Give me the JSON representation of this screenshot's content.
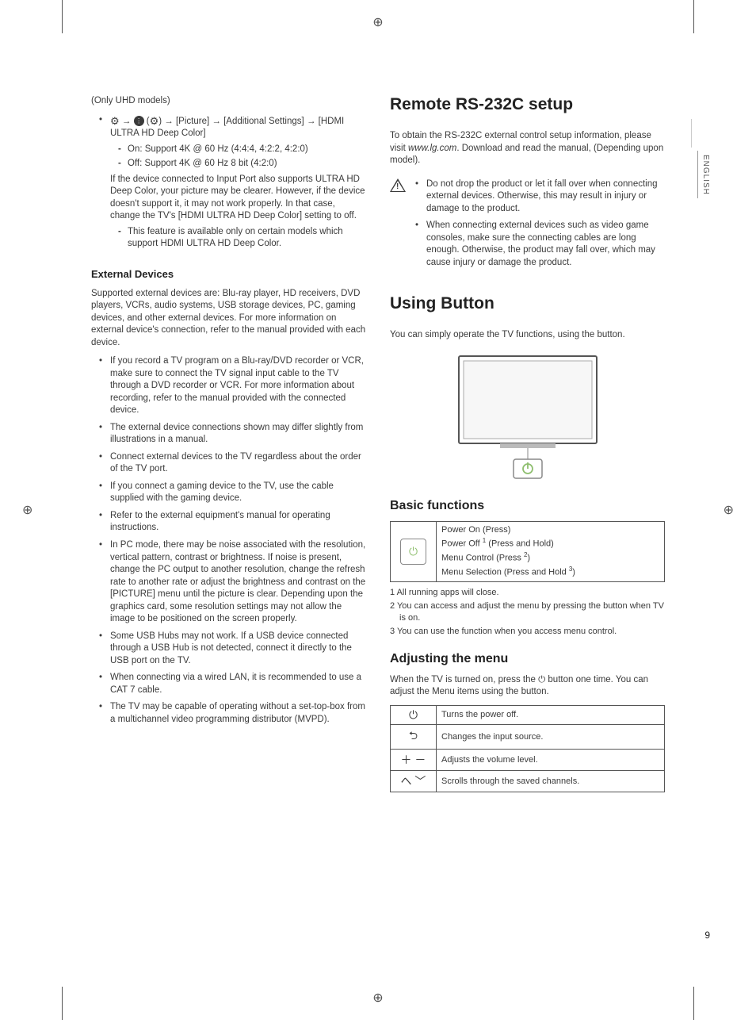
{
  "sidebar": {
    "language": "ENGLISH"
  },
  "page_number": "9",
  "left": {
    "uhd_note": "(Only UHD models)",
    "menu_path": {
      "arrow": "→",
      "picture": "[Picture]",
      "additional": "[Additional Settings]",
      "hdmi": "[HDMI ULTRA HD Deep Color]"
    },
    "uhd_options": {
      "on": "On: Support 4K @ 60 Hz (4:4:4, 4:2:2, 4:2:0)",
      "off": "Off: Support 4K @ 60 Hz 8 bit (4:2:0)"
    },
    "uhd_desc": "If the device connected to Input Port also supports ULTRA HD Deep Color, your picture may be clearer. However, if the device doesn't support it, it may not work properly. In that case, change the TV's [HDMI ULTRA HD Deep Color] setting to off.",
    "uhd_feature_note": "This feature is available only on certain models which support HDMI ULTRA HD Deep Color.",
    "ext_heading": "External Devices",
    "ext_intro": "Supported external devices are: Blu-ray player, HD receivers, DVD players, VCRs, audio systems, USB storage devices, PC, gaming devices, and other external devices. For more information on external device's connection, refer to the manual provided with each device.",
    "ext_bullets": [
      "If you record a TV program on a Blu-ray/DVD recorder or VCR, make sure to connect the TV signal input cable to the TV through a DVD recorder or VCR. For more information about recording, refer to the manual provided with the connected device.",
      "The external device connections shown may differ slightly from illustrations in a manual.",
      "Connect external devices to the TV regardless about the order of the TV port.",
      "If you connect a gaming device to the TV, use the cable supplied with the gaming device.",
      "Refer to the external equipment's manual for operating instructions.",
      "In PC mode, there may be noise associated with the resolution, vertical pattern, contrast or brightness. If noise is present, change the PC output to another resolution, change the refresh rate to another rate or adjust the brightness and contrast on the [PICTURE] menu until the picture is clear. Depending upon the graphics card, some resolution settings may not allow the image to be positioned on the screen properly.",
      "Some USB Hubs may not work. If a USB device connected through a USB Hub is not detected, connect it directly to the USB port on the TV.",
      "When connecting via a wired LAN, it is recommended to use a CAT 7 cable.",
      "The TV may be capable of operating without a set-top-box from a multichannel video programming distributor (MVPD)."
    ]
  },
  "right": {
    "rs232c_title": "Remote RS-232C setup",
    "rs232c_intro_a": "To obtain the RS-232C external control setup information, please visit ",
    "rs232c_url": "www.lg.com",
    "rs232c_intro_b": ". Download and read the manual, (Depending upon model).",
    "warnings": [
      "Do not drop the product or let it fall over when connecting external devices. Otherwise, this may result in injury or damage to the product.",
      "When connecting external devices such as video game consoles, make sure the connecting cables are long enough. Otherwise, the product may fall over, which may cause injury or damage the product."
    ],
    "using_button_title": "Using Button",
    "using_button_intro": "You can simply operate the TV functions, using the button.",
    "basic_functions_title": "Basic functions",
    "basic_functions": {
      "row1": "Power On (Press)",
      "row2_a": "Power Off ",
      "row2_sup": "1",
      "row2_b": " (Press and Hold)",
      "row3_a": "Menu Control (Press ",
      "row3_sup": "2",
      "row3_b": ")",
      "row4_a": "Menu Selection (Press and Hold ",
      "row4_sup": "3",
      "row4_b": ")"
    },
    "footnotes": [
      "1  All running apps will close.",
      "2  You can access and adjust the menu by pressing the button when TV is on.",
      "3  You can use the function when you access menu control."
    ],
    "adjusting_title": "Adjusting the menu",
    "adjusting_intro_a": "When the TV is turned on, press the ",
    "adjusting_intro_b": " button one time. You can adjust the Menu items using the button.",
    "menu_rows": [
      {
        "icon": "⏻",
        "desc": "Turns the power off."
      },
      {
        "icon": "⮌",
        "desc": "Changes the input source."
      },
      {
        "icon": "＋ －",
        "desc": "Adjusts the volume level."
      },
      {
        "icon": "ヘ ﹀",
        "desc": "Scrolls through the saved channels."
      }
    ]
  }
}
